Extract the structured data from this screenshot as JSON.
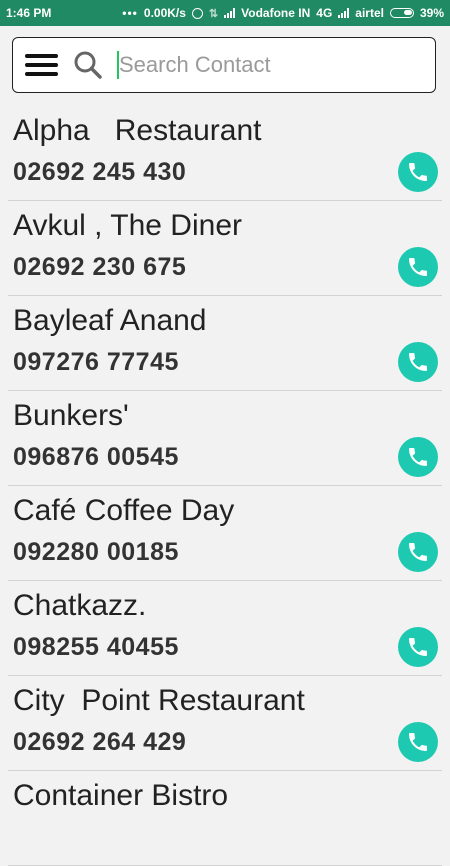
{
  "status_bar": {
    "time": "1:46 PM",
    "speed": "0.00K/s",
    "carrier1": "Vodafone IN",
    "network": "4G",
    "carrier2": "airtel",
    "battery": "39%"
  },
  "search": {
    "placeholder": "Search Contact"
  },
  "contacts": [
    {
      "name": "Alpha   Restaurant",
      "phone": "02692 245 430"
    },
    {
      "name": "Avkul , The Diner",
      "phone": "02692 230 675"
    },
    {
      "name": "Bayleaf Anand",
      "phone": "097276 77745"
    },
    {
      "name": "Bunkers'",
      "phone": "096876 00545"
    },
    {
      "name": "Café Coffee Day",
      "phone": "092280 00185"
    },
    {
      "name": "Chatkazz.",
      "phone": "098255 40455"
    },
    {
      "name": "City  Point Restaurant",
      "phone": "02692 264 429"
    },
    {
      "name": "Container Bistro",
      "phone": ""
    }
  ],
  "colors": {
    "status_bar": "#1f8a63",
    "call_button": "#1dc9b0"
  },
  "icons": [
    "menu-icon",
    "search-icon",
    "phone-call-icon"
  ]
}
